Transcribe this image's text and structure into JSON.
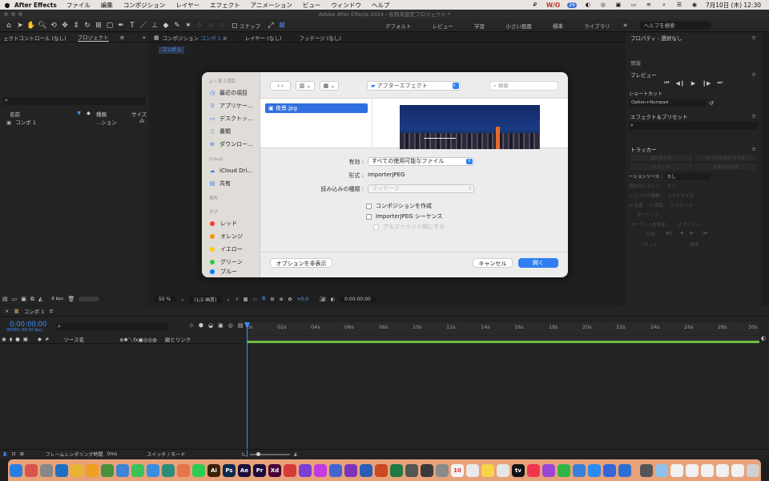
{
  "menubar": {
    "app": "After Effects",
    "items": [
      "ファイル",
      "編集",
      "コンポジション",
      "レイヤー",
      "エフェクト",
      "アニメーション",
      "ビュー",
      "ウィンドウ",
      "ヘルプ"
    ],
    "clock": "7月10日 (木)  12:30",
    "status_badge": "W/O",
    "status_num": "26"
  },
  "window_title": "Adobe After Effects 2024 - 名称未設定プロジェクト *",
  "toolbar": {
    "snap_label": "スナップ",
    "workspaces": [
      "デフォルト",
      "レビュー",
      "学習",
      "小さい画面",
      "標準",
      "ライブラリ"
    ],
    "help_search": "ヘルプを検索"
  },
  "left_panel": {
    "tab_effects": "ェクトコントロール (なし)",
    "tab_project": "プロジェクト",
    "col_name": "名前",
    "col_type": "種類",
    "col_size": "サイズ",
    "item_name": "コンポ 1",
    "item_type": "...ション",
    "bpc": "8 bpc"
  },
  "comp_panel": {
    "tab_comp": "コンポジション",
    "tab_comp_name": "コンポ 1",
    "tab_layer": "レイヤー (なし)",
    "tab_footage": "フッテージ (なし)",
    "breadcrumb": "コンポ 1",
    "zoom": "50 %",
    "resolution": "(1/2 画質)",
    "exposure": "+0.0",
    "timecode": "0:00:00:00"
  },
  "right_panel": {
    "properties": "プロパティ : 選択なし",
    "info": "情報",
    "preview": "プレビュー",
    "shortcut_label": "ショートカット",
    "shortcut_value": "Option+Numpad .",
    "effects_presets": "エフェクト＆プリセット",
    "tracker": "トラッカー",
    "tracker_items": [
      "3D カメラ",
      "ワープスタビライズ",
      "トラック",
      "スタビライズ"
    ],
    "motion_source_label": "ーションソース :",
    "motion_source_value": "なし",
    "current_track_label": "現在のトラック :",
    "current_track_value": "なし",
    "track_type_label": "トラックの種類 :",
    "track_type_value": "スタビライズ",
    "opt_position": "位置",
    "opt_rotation": "回転",
    "opt_scale": "スケール",
    "target_label": "ターゲット :",
    "set_target": "ターゲットを設定...",
    "options": "オプション...",
    "analyze": "分析 :",
    "reset": "リセット",
    "apply": "適用"
  },
  "dialog": {
    "sidebar": {
      "favorites_head": "よく使う項目",
      "favorites": [
        {
          "icon": "recent-icon",
          "label": "最近の項目"
        },
        {
          "icon": "applications-icon",
          "label": "アプリケー..."
        },
        {
          "icon": "desktop-icon",
          "label": "デスクトッ..."
        },
        {
          "icon": "documents-icon",
          "label": "書類"
        },
        {
          "icon": "downloads-icon",
          "label": "ダウンロー..."
        }
      ],
      "icloud_head": "iCloud",
      "icloud": [
        {
          "icon": "cloud-icon",
          "label": "iCloud Dri..."
        },
        {
          "icon": "shared-icon",
          "label": "共有"
        }
      ],
      "places_head": "場所",
      "tags_head": "タグ",
      "tags": [
        {
          "label": "レッド",
          "color": "#ff3b30"
        },
        {
          "label": "オレンジ",
          "color": "#ff9500"
        },
        {
          "label": "イエロー",
          "color": "#ffcc00"
        },
        {
          "label": "グリーン",
          "color": "#28cd41"
        },
        {
          "label": "ブルー",
          "color": "#007aff"
        }
      ]
    },
    "folder": "アフターエフェクト",
    "search_placeholder": "検索",
    "selected_file": "夜景.jpg",
    "enable_label": "有効 :",
    "enable_value": "すべての使用可能なファイル",
    "format_label": "形式 :",
    "format_value": "ImporterJPEG",
    "import_as_label": "読み込みの種類 :",
    "import_as_value": "フッテージ",
    "create_comp": "コンポジションを作成",
    "sequence": "ImporterJPEG シーケンス",
    "alpha_order": "アルファベット順にする",
    "hide_options": "オプションを非表示",
    "cancel": "キャンセル",
    "open": "開く"
  },
  "timeline": {
    "comp_tab": "コンポ 1",
    "timecode": "0:00:00:00",
    "frame_info": "00000 (30.00 fps)",
    "source_name": "ソース名",
    "parent_link": "親とリンク",
    "ruler": [
      "0s",
      "02s",
      "04s",
      "06s",
      "08s",
      "10s",
      "12s",
      "14s",
      "16s",
      "18s",
      "20s",
      "22s",
      "24s",
      "26s",
      "28s",
      "30s"
    ],
    "footer_render": "フレームレンダリング時間",
    "footer_render_val": "0ms",
    "footer_switch": "スイッチ / モード"
  },
  "dock": {
    "apps": [
      {
        "name": "finder-icon",
        "label": "",
        "color": "#2a7de1"
      },
      {
        "name": "launchpad-icon",
        "label": "",
        "color": "#d9534f"
      },
      {
        "name": "settings-icon",
        "label": "",
        "color": "#888888"
      },
      {
        "name": "vscode-icon",
        "label": "",
        "color": "#1f6fc2"
      },
      {
        "name": "chrome-icon",
        "label": "",
        "color": "#e9b430"
      },
      {
        "name": "app-icon",
        "label": "",
        "color": "#f0a020"
      },
      {
        "name": "app-icon",
        "label": "",
        "color": "#4a8f3a"
      },
      {
        "name": "app-icon",
        "label": "",
        "color": "#3d83d6"
      },
      {
        "name": "messages-icon",
        "label": "",
        "color": "#3dc15a"
      },
      {
        "name": "mail-icon",
        "label": "",
        "color": "#3b8de0"
      },
      {
        "name": "app-icon",
        "label": "",
        "color": "#2d8c7a"
      },
      {
        "name": "photos-icon",
        "label": "",
        "color": "#e7734a"
      },
      {
        "name": "facetime-icon",
        "label": "",
        "color": "#2ecc52"
      },
      {
        "name": "illustrator-icon",
        "label": "Ai",
        "color": "#3b1f05"
      },
      {
        "name": "photoshop-icon",
        "label": "Ps",
        "color": "#0c2a4d"
      },
      {
        "name": "aftereffects-icon",
        "label": "Ae",
        "color": "#1a0f3a"
      },
      {
        "name": "premiere-icon",
        "label": "Pr",
        "color": "#1a0b3a"
      },
      {
        "name": "xd-icon",
        "label": "Xd",
        "color": "#470137"
      },
      {
        "name": "app-icon",
        "label": "",
        "color": "#d63b3b"
      },
      {
        "name": "imovie-icon",
        "label": "",
        "color": "#7a3fd6"
      },
      {
        "name": "app-icon",
        "label": "",
        "color": "#c13be0"
      },
      {
        "name": "app-icon",
        "label": "",
        "color": "#4465d0"
      },
      {
        "name": "onenote-icon",
        "label": "",
        "color": "#7d34b8"
      },
      {
        "name": "word-icon",
        "label": "",
        "color": "#2b5cb8"
      },
      {
        "name": "powerpoint-icon",
        "label": "",
        "color": "#c94a24"
      },
      {
        "name": "excel-icon",
        "label": "",
        "color": "#1f7a44"
      },
      {
        "name": "app-icon",
        "label": "",
        "color": "#555555"
      },
      {
        "name": "app-icon",
        "label": "",
        "color": "#3a3a3a"
      },
      {
        "name": "app-icon",
        "label": "",
        "color": "#8a8a8a"
      },
      {
        "name": "calendar-icon",
        "label": "10",
        "color": "#f4f4f4"
      },
      {
        "name": "app-icon",
        "label": "",
        "color": "#eaeaea"
      },
      {
        "name": "notes-icon",
        "label": "",
        "color": "#f7d548"
      },
      {
        "name": "app-icon",
        "label": "",
        "color": "#e6e6e6"
      },
      {
        "name": "appletv-icon",
        "label": "tv",
        "color": "#111111"
      },
      {
        "name": "music-icon",
        "label": "",
        "color": "#f0364e"
      },
      {
        "name": "podcasts-icon",
        "label": "",
        "color": "#9b46d6"
      },
      {
        "name": "numbers-icon",
        "label": "",
        "color": "#2fb548"
      },
      {
        "name": "keynote-icon",
        "label": "",
        "color": "#3a7fd6"
      },
      {
        "name": "appstore-icon",
        "label": "",
        "color": "#2a8cf0"
      },
      {
        "name": "app-icon",
        "label": "",
        "color": "#3567d8"
      },
      {
        "name": "app-icon",
        "label": "",
        "color": "#2e6fd6"
      },
      {
        "name": "app-icon",
        "label": "",
        "color": "#555555"
      },
      {
        "name": "folder-icon",
        "label": "",
        "color": "#8fc1ea"
      },
      {
        "name": "folder-icon",
        "label": "",
        "color": "#f1f1f1"
      },
      {
        "name": "folder-icon",
        "label": "",
        "color": "#f1f1f1"
      },
      {
        "name": "folder-icon",
        "label": "",
        "color": "#f1f1f1"
      },
      {
        "name": "folder-icon",
        "label": "",
        "color": "#f1f1f1"
      },
      {
        "name": "folder-icon",
        "label": "",
        "color": "#f1f1f1"
      },
      {
        "name": "trash-icon",
        "label": "",
        "color": "#d0d0d0"
      }
    ]
  }
}
